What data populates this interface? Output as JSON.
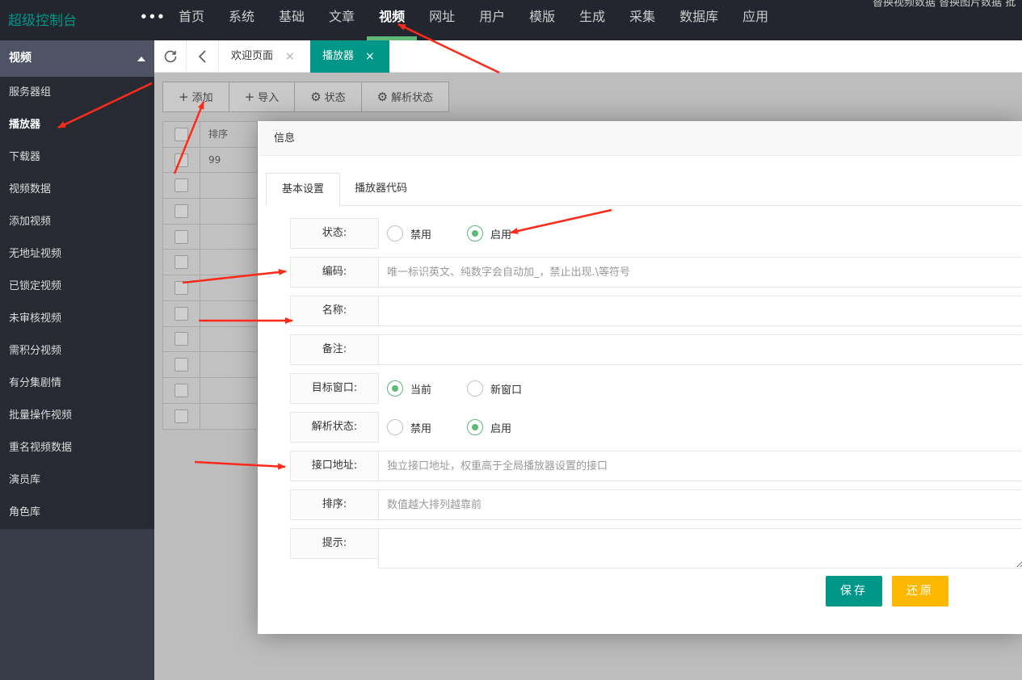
{
  "header": {
    "logo": "超级控制台",
    "more": "•••",
    "nav": [
      "首页",
      "系统",
      "基础",
      "文章",
      "视频",
      "网址",
      "用户",
      "模版",
      "生成",
      "采集",
      "数据库",
      "应用"
    ],
    "active_nav": "视频",
    "top_right_text": "替换视频数据 替换图片数据 批"
  },
  "sidebar": {
    "title": "视频",
    "items": [
      "服务器组",
      "播放器",
      "下载器",
      "视频数据",
      "添加视频",
      "无地址视频",
      "已锁定视频",
      "未审核视频",
      "需积分视频",
      "有分集剧情",
      "批量操作视频",
      "重名视频数据",
      "演员库",
      "角色库"
    ],
    "active_item": "播放器"
  },
  "tabbar": {
    "tabs": [
      {
        "label": "欢迎页面",
        "close": "×"
      },
      {
        "label": "播放器",
        "close": "×"
      }
    ]
  },
  "toolbar": {
    "buttons": [
      {
        "icon": "+",
        "label": "添加"
      },
      {
        "icon": "+",
        "label": "导入"
      },
      {
        "icon": "⚙",
        "label": "状态"
      },
      {
        "icon": "⚙",
        "label": "解析状态"
      }
    ]
  },
  "table": {
    "header": "排序",
    "first_value": "99"
  },
  "modal": {
    "title": "信息",
    "tabs": [
      "基本设置",
      "播放器代码"
    ],
    "fields": {
      "status": {
        "label": "状态:",
        "options": [
          "禁用",
          "启用"
        ],
        "selected": "启用"
      },
      "code": {
        "label": "编码:",
        "placeholder": "唯一标识英文、纯数字会自动加_，禁止出现.\\等符号"
      },
      "name": {
        "label": "名称:",
        "placeholder": ""
      },
      "note": {
        "label": "备注:",
        "placeholder": ""
      },
      "target": {
        "label": "目标窗口:",
        "options": [
          "当前",
          "新窗口"
        ],
        "selected": "当前"
      },
      "parse_status": {
        "label": "解析状态:",
        "options": [
          "禁用",
          "启用"
        ],
        "selected": "启用"
      },
      "api_url": {
        "label": "接口地址:",
        "placeholder": "独立接口地址，权重高于全局播放器设置的接口"
      },
      "sort": {
        "label": "排序:",
        "placeholder": "数值越大排列越靠前"
      },
      "tip": {
        "label": "提示:",
        "placeholder": ""
      }
    },
    "save_label": "保存",
    "reset_label": "还原"
  },
  "colors": {
    "accent": "#009688",
    "radio_checked": "#5fb878",
    "reset_button": "#ffb800",
    "annotation_arrow": "#ff2a1a"
  }
}
